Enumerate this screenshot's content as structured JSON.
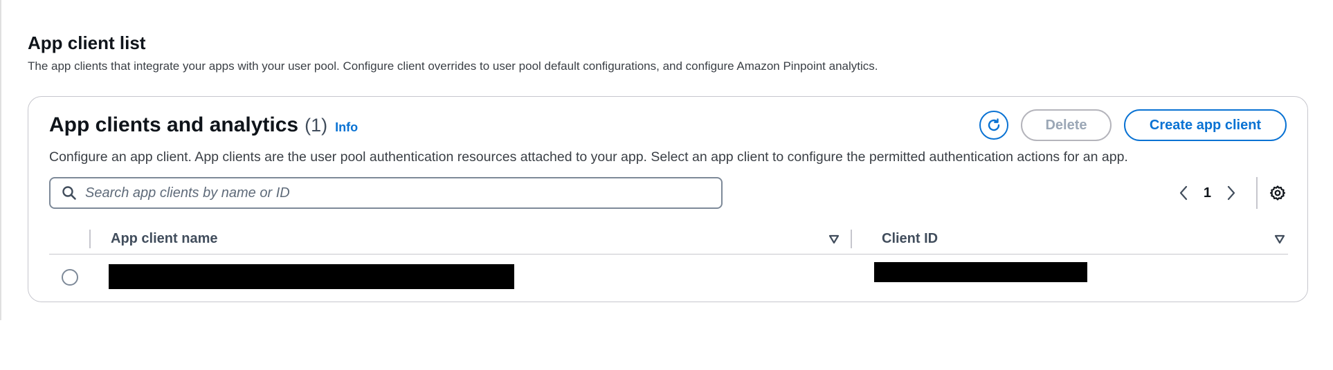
{
  "section": {
    "title": "App client list",
    "description": "The app clients that integrate your apps with your user pool. Configure client overrides to user pool default configurations, and configure Amazon Pinpoint analytics."
  },
  "panel": {
    "title": "App clients and analytics",
    "count": "(1)",
    "info_link": "Info",
    "description": "Configure an app client. App clients are the user pool authentication resources attached to your app. Select an app client to configure the permitted authentication actions for an app.",
    "actions": {
      "refresh_icon": "refresh-icon",
      "delete_label": "Delete",
      "delete_disabled": true,
      "create_label": "Create app client"
    },
    "search": {
      "placeholder": "Search app clients by name or ID",
      "value": "",
      "icon": "search-icon"
    },
    "pagination": {
      "current_page": "1",
      "prev_icon": "chevron-left-icon",
      "next_icon": "chevron-right-icon",
      "settings_icon": "gear-icon"
    },
    "table": {
      "columns": [
        {
          "label": "App client name",
          "sortable": true
        },
        {
          "label": "Client ID",
          "sortable": true
        }
      ],
      "rows": [
        {
          "selected": false,
          "app_client_name": "[redacted]",
          "client_id": "[redacted]"
        }
      ]
    }
  },
  "colors": {
    "accent": "#0972d3",
    "text": "#0f141a",
    "border": "#c6c6cd",
    "disabled": "#9ba7b6"
  }
}
